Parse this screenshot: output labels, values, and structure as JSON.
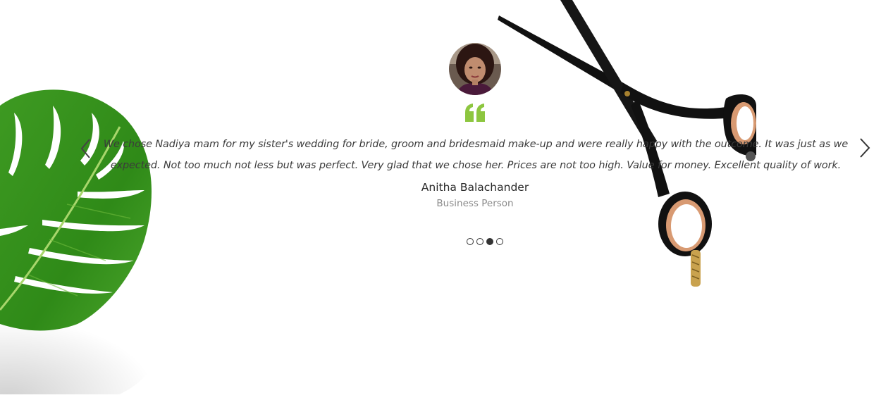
{
  "testimonial": {
    "text": "We chose Nadiya mam for my sister's wedding for bride, groom and bridesmaid make-up and were really happy with the outcome. It was just as we expected. Not too much not less but was perfect. Very glad that we chose her. Prices are not too high. Value for money. Excellent quality of work.",
    "author_name": "Anitha Balachander",
    "author_role": "Business Person"
  },
  "carousel": {
    "prev_icon": "chevron-left-icon",
    "next_icon": "chevron-right-icon",
    "slide_count": 4,
    "active_index": 2
  },
  "colors": {
    "quote_accent": "#8dc63f",
    "text": "#3b3b3b",
    "muted": "#8a8a8a",
    "dot": "#333333"
  },
  "icons": {
    "quote": "quote-icon",
    "leaf": "monstera-leaf-decoration",
    "scissors": "scissors-decoration"
  }
}
